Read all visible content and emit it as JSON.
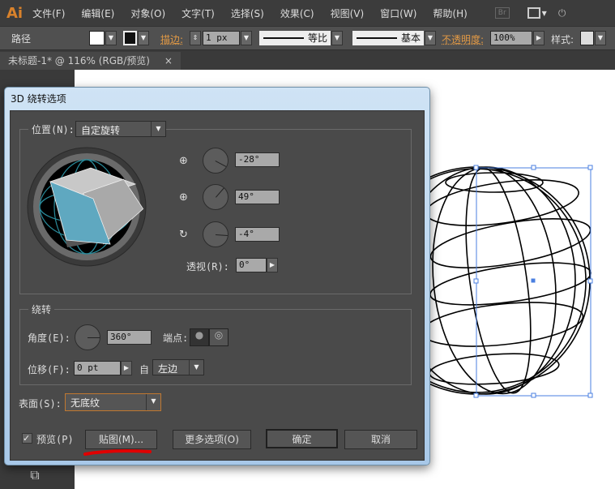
{
  "app": {
    "logo": "Ai",
    "menus": [
      "文件(F)",
      "编辑(E)",
      "对象(O)",
      "文字(T)",
      "选择(S)",
      "效果(C)",
      "视图(V)",
      "窗口(W)",
      "帮助(H)"
    ],
    "br_label": "Br"
  },
  "control": {
    "object_type": "路径",
    "stroke_label": "描边:",
    "stroke_weight": "1 px",
    "profile_label": "等比",
    "brush_label": "基本",
    "opacity_label": "不透明度:",
    "opacity_value": "100%",
    "style_label": "样式:"
  },
  "document_tab": {
    "title": "未标题-1* @ 116% (RGB/预览)",
    "close": "×"
  },
  "dialog": {
    "title": "3D 绕转选项",
    "position_label": "位置(N):",
    "position_value": "自定旋转",
    "x_rotation": "-28°",
    "y_rotation": "49°",
    "z_rotation": "-4°",
    "perspective_label": "透视(R):",
    "perspective_value": "0°",
    "revolve_group": "绕转",
    "angle_label": "角度(E):",
    "angle_value": "360°",
    "cap_label": "端点:",
    "offset_label": "位移(F):",
    "offset_value": "0 pt",
    "from_label": "自",
    "from_value": "左边",
    "surface_label": "表面(S):",
    "surface_value": "无底纹",
    "preview_label": "预览(P)",
    "preview_checked": true,
    "map_art_button": "贴图(M)...",
    "more_options_button": "更多选项(O)",
    "ok_button": "确定",
    "cancel_button": "取消"
  },
  "colors": {
    "accent": "#e39a45",
    "cube_side": "#5fa8c0",
    "annotation": "#e00000"
  }
}
